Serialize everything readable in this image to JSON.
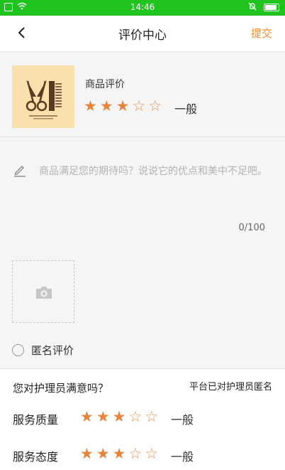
{
  "status_bar": {
    "time": "14:46"
  },
  "header": {
    "title": "评价中心",
    "submit_label": "提交"
  },
  "product": {
    "label": "商品评价",
    "rating": 3,
    "max_rating": 5,
    "rating_word": "一般"
  },
  "comment": {
    "placeholder": "商品满足您的期待吗？说说它的优点和美中不足吧。",
    "count": "0/100"
  },
  "anonymous": {
    "label": "匿名评价",
    "checked": false
  },
  "nurse": {
    "question": "您对护理员满意吗？",
    "note": "平台已对护理员匿名",
    "rows": [
      {
        "label": "服务质量",
        "rating": 3,
        "word": "一般"
      },
      {
        "label": "服务态度",
        "rating": 3,
        "word": "一般"
      }
    ]
  },
  "colors": {
    "status_bar": "#1fc41f",
    "accent": "#e8843a",
    "submit": "#f08c2a"
  },
  "icons": {
    "back": "chevron-left-icon",
    "edit": "pencil-icon",
    "photo": "camera-icon",
    "radio": "radio-unchecked-icon"
  }
}
